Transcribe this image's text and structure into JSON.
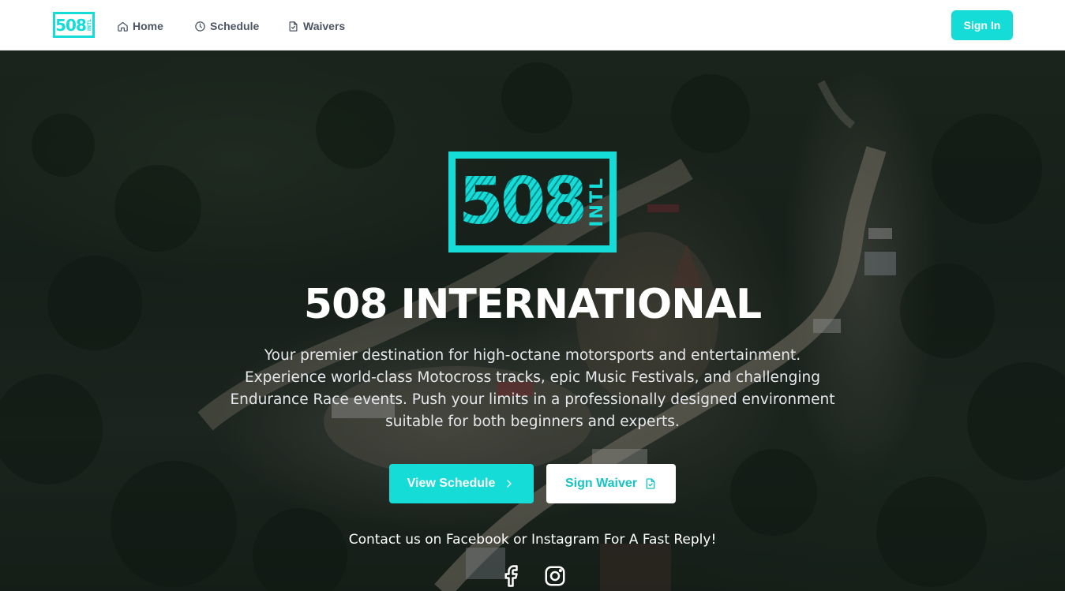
{
  "nav": {
    "logo_number": "508",
    "logo_sub": "INTL",
    "links": [
      {
        "label": "Home",
        "icon": "home-icon"
      },
      {
        "label": "Schedule",
        "icon": "clock-icon"
      },
      {
        "label": "Waivers",
        "icon": "file-icon"
      }
    ],
    "signin_label": "Sign In"
  },
  "hero": {
    "logo_number": "508",
    "logo_sub": "INTL",
    "title": "508 INTERNATIONAL",
    "description": "Your premier destination for high-octane motorsports and entertainment. Experience world-class Motocross tracks, epic Music Festivals, and challenging Endurance Race events. Push your limits in a professionally designed environment suitable for both beginners and experts.",
    "view_schedule_label": "View Schedule",
    "sign_waiver_label": "Sign Waiver",
    "contact_text": "Contact us on Facebook or Instagram For A Fast Reply!",
    "social": [
      "facebook-icon",
      "instagram-icon"
    ]
  },
  "colors": {
    "accent": "#16dcd8",
    "nav_text": "#4b5563",
    "white": "#ffffff"
  }
}
